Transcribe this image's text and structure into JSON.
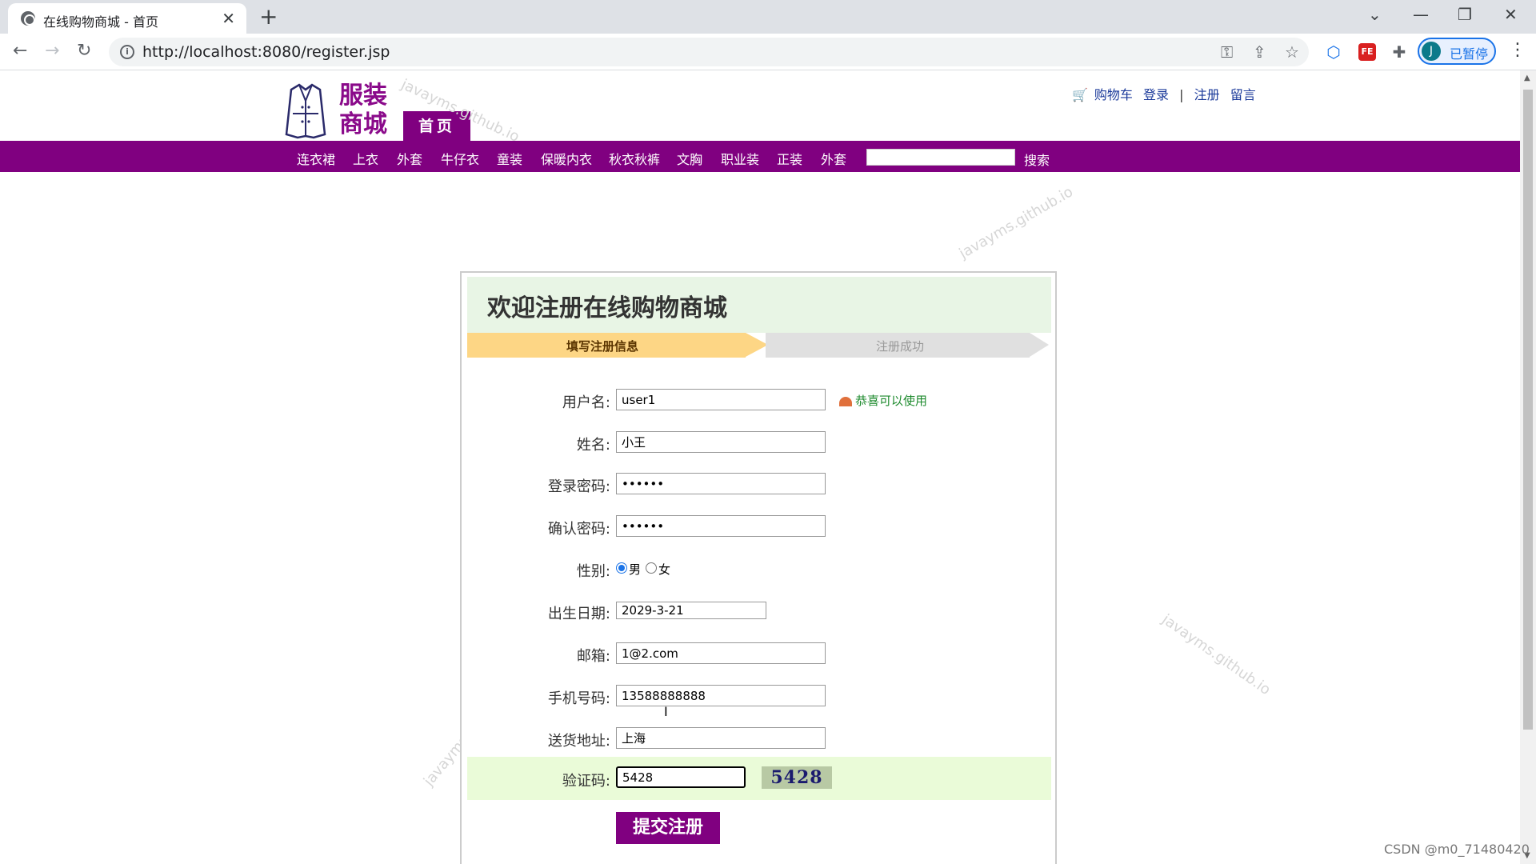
{
  "browser": {
    "tab_title": "在线购物商城 - 首页",
    "tab_close": "✕",
    "new_tab": "+",
    "url": "http://localhost:8080/register.jsp",
    "profile_initial": "J",
    "profile_label": "已暂停",
    "ext_fe_label": "FE",
    "window_controls": {
      "dropdown": "⌄",
      "minimize": "—",
      "restore": "❐",
      "close": "✕"
    }
  },
  "header": {
    "logo_text_line1": "服装",
    "logo_text_line2": "商城",
    "home_tab": "首页",
    "toplinks": {
      "cart": "购物车",
      "login": "登录",
      "separator": "|",
      "register": "注册",
      "message": "留言"
    }
  },
  "nav": {
    "items": [
      "连衣裙",
      "上衣",
      "外套",
      "牛仔衣",
      "童装",
      "保暖内衣",
      "秋衣秋裤",
      "文胸",
      "职业装",
      "正装",
      "外套"
    ],
    "search_value": "",
    "search_button": "搜索"
  },
  "watermark_text": "javayms.github.io",
  "register": {
    "title": "欢迎注册在线购物商城",
    "steps": [
      "填写注册信息",
      "注册成功"
    ],
    "fields": {
      "username": {
        "label": "用户名:",
        "value": "user1",
        "check_msg": "恭喜可以使用"
      },
      "name": {
        "label": "姓名:",
        "value": "小王"
      },
      "password": {
        "label": "登录密码:",
        "value": "••••••"
      },
      "confirm_password": {
        "label": "确认密码:",
        "value": "••••••"
      },
      "gender": {
        "label": "性别:",
        "options": [
          "男",
          "女"
        ],
        "selected": "男"
      },
      "birthday": {
        "label": "出生日期:",
        "value": "2029-3-21"
      },
      "email": {
        "label": "邮箱:",
        "value": "1@2.com"
      },
      "phone": {
        "label": "手机号码:",
        "value": "13588888888"
      },
      "address": {
        "label": "送货地址:",
        "value": "上海"
      },
      "captcha": {
        "label": "验证码:",
        "value": "5428",
        "image_text": "5428"
      }
    },
    "submit": "提交注册"
  },
  "footer_mark": "CSDN @m0_71480420",
  "colors": {
    "brand_purple": "#800080",
    "title_bg": "#e8f5e5",
    "step_active": "#fdd685",
    "captcha_row_bg": "#eafbd8",
    "ok_green": "#1d8a2d"
  }
}
